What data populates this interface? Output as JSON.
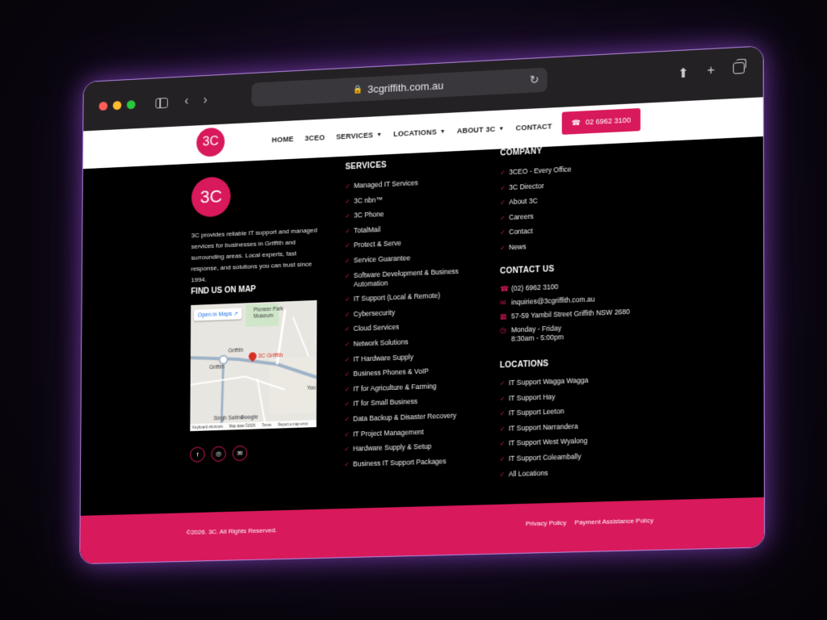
{
  "browser": {
    "url": "3cgriffith.com.au",
    "colors": {
      "close": "#ff5f57",
      "minimize": "#febc2e",
      "maximize": "#28c840"
    },
    "icons": [
      "sidebar-icon",
      "back-icon",
      "forward-icon",
      "lock-icon",
      "reload-icon",
      "share-icon",
      "new-tab-icon",
      "tabs-icon"
    ]
  },
  "header": {
    "logo": "3C",
    "nav": [
      {
        "label": "HOME",
        "dropdown": false
      },
      {
        "label": "3CEO",
        "dropdown": false
      },
      {
        "label": "SERVICES",
        "dropdown": true
      },
      {
        "label": "LOCATIONS",
        "dropdown": true
      },
      {
        "label": "ABOUT 3C",
        "dropdown": true
      },
      {
        "label": "CONTACT",
        "dropdown": false
      }
    ],
    "phone_button": "02 6962 3100"
  },
  "about": {
    "logo": "3C",
    "text": "3C provides reliable IT support and managed services for businesses in Griffith and surrounding areas. Local experts, fast response, and solutions you can trust since 1994."
  },
  "map_section": {
    "title": "FIND US ON MAP",
    "open_in_maps": "Open in Maps",
    "labels": {
      "museum": "Pioneer Park Museum",
      "griffith_north": "Griffith",
      "griffith_west": "Griffith",
      "pin": "3C Griffith",
      "yoo": "Yoo",
      "singh": "Singh Sabha",
      "google": "Google"
    },
    "footer": [
      "Keyboard shortcuts",
      "Map data ©2026",
      "Terms",
      "Report a map error"
    ]
  },
  "socials": [
    "facebook-icon",
    "instagram-icon",
    "email-icon"
  ],
  "services": {
    "title": "SERVICES",
    "items": [
      "Managed IT Services",
      "3C nbn™",
      "3C Phone",
      "TotalMail",
      "Protect & Serve",
      "Service Guarantee",
      "Software Development & Business Automation",
      "IT Support (Local & Remote)",
      "Cybersecurity",
      "Cloud Services",
      "Network Solutions",
      "IT Hardware Supply",
      "Business Phones & VoIP",
      "IT for Agriculture & Farming",
      "IT for Small Business",
      "Data Backup & Disaster Recovery",
      "IT Project Management",
      "Hardware Supply & Setup",
      "Business IT Support Packages"
    ]
  },
  "company": {
    "title": "COMPANY",
    "items": [
      "3CEO - Every Office",
      "3C Director",
      "About 3C",
      "Careers",
      "Contact",
      "News"
    ]
  },
  "contact": {
    "title": "CONTACT US",
    "phone": "(02) 6962 3100",
    "email": "inquiries@3cgriffith.com.au",
    "address": "57-59 Yambil Street Griffith NSW 2680",
    "hours_days": "Monday - Friday",
    "hours_time": "8:30am - 5:00pm"
  },
  "locations": {
    "title": "LOCATIONS",
    "items": [
      "IT Support Wagga Wagga",
      "IT Support Hay",
      "IT Support Leeton",
      "IT Support Narrandera",
      "IT Support West Wyalong",
      "IT Support Coleambally",
      "All Locations"
    ]
  },
  "bottom": {
    "copyright": "©2026. 3C. All Rights Reserved.",
    "privacy": "Privacy Policy",
    "payment": "Payment Assistance Policy"
  },
  "brand_color": "#d8195b"
}
